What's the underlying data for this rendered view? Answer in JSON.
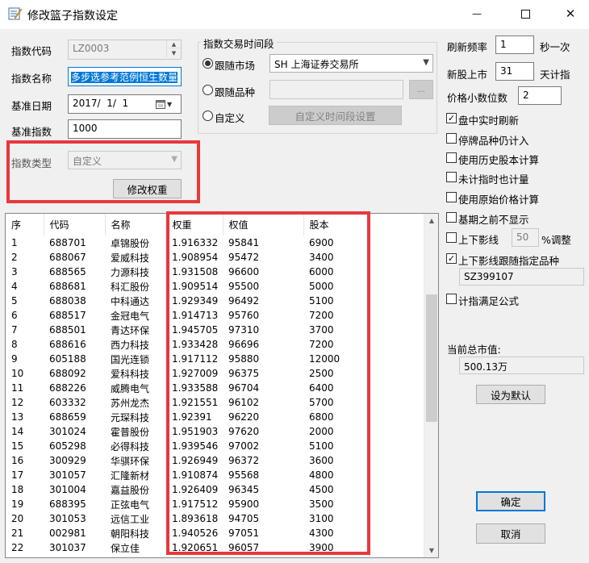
{
  "window": {
    "title": "修改篮子指数设定",
    "minimize_glyph": "—",
    "close_glyph": "✕"
  },
  "form": {
    "code_label": "指数代码",
    "code_value": "LZ0003",
    "name_label": "指数名称",
    "name_value": "多步选参考范例恒生数量",
    "base_date_label": "基准日期",
    "base_date_value": "2017/  1/  1",
    "base_index_label": "基准指数",
    "base_index_value": "1000",
    "type_label": "指数类型",
    "type_value": "自定义",
    "modify_weight_button": "修改权重"
  },
  "trade_time": {
    "group_title": "指数交易时间段",
    "follow_market_label": "跟随市场",
    "market_value": "SH 上海证券交易所",
    "follow_variety_label": "跟随品种",
    "variety_value": "",
    "browse_button": "...",
    "custom_label": "自定义",
    "custom_period_button": "自定义时间段设置",
    "selected": "follow_market"
  },
  "settings": {
    "refresh_label": "刷新频率",
    "refresh_value": "1",
    "refresh_unit": "秒一次",
    "new_stock_label": "新股上市",
    "new_stock_value": "31",
    "new_stock_unit": "天计指",
    "decimal_label": "价格小数位数",
    "decimal_value": "2",
    "checkboxes": [
      {
        "label": "盘中实时刷新",
        "checked": true
      },
      {
        "label": "停牌品种仍计入",
        "checked": false
      },
      {
        "label": "使用历史股本计算",
        "checked": false
      },
      {
        "label": "未计指时也计量",
        "checked": false
      },
      {
        "label": "使用原始价格计算",
        "checked": false
      },
      {
        "label": "基期之前不显示",
        "checked": false
      }
    ],
    "shadow_label": "上下影线",
    "shadow_value": "50",
    "shadow_unit": "%调整",
    "shadow_checked": false,
    "follow_shadow_label": "上下影线跟随指定品种",
    "follow_shadow_checked": true,
    "follow_shadow_value": "SZ399107",
    "formula_label": "计指满足公式",
    "formula_checked": false,
    "market_value_label": "当前总市值:",
    "market_value_value": "500.13万",
    "set_default_button": "设为默认",
    "ok_button": "确定",
    "cancel_button": "取消"
  },
  "table": {
    "headers": [
      "序",
      "代码",
      "名称",
      "权重",
      "权值",
      "股本"
    ],
    "rows": [
      [
        "1",
        "688701",
        "卓锦股份",
        "1.916332",
        "95841",
        "6900"
      ],
      [
        "2",
        "688067",
        "爱威科技",
        "1.908954",
        "95472",
        "3400"
      ],
      [
        "3",
        "688565",
        "力源科技",
        "1.931508",
        "96600",
        "6000"
      ],
      [
        "4",
        "688681",
        "科汇股份",
        "1.909514",
        "95500",
        "5000"
      ],
      [
        "5",
        "688038",
        "中科通达",
        "1.929349",
        "96492",
        "5100"
      ],
      [
        "6",
        "688517",
        "金冠电气",
        "1.914713",
        "95760",
        "7200"
      ],
      [
        "7",
        "688501",
        "青达环保",
        "1.945705",
        "97310",
        "3700"
      ],
      [
        "8",
        "688616",
        "西力科技",
        "1.933428",
        "96696",
        "7200"
      ],
      [
        "9",
        "605188",
        "国光连锁",
        "1.917112",
        "95880",
        "12000"
      ],
      [
        "10",
        "688092",
        "爱科科技",
        "1.927009",
        "96375",
        "2500"
      ],
      [
        "11",
        "688226",
        "威腾电气",
        "1.933588",
        "96704",
        "6400"
      ],
      [
        "12",
        "603332",
        "苏州龙杰",
        "1.921551",
        "96102",
        "5700"
      ],
      [
        "13",
        "688659",
        "元琛科技",
        "1.92391",
        "96220",
        "6800"
      ],
      [
        "14",
        "301024",
        "霍普股份",
        "1.951903",
        "97620",
        "2000"
      ],
      [
        "15",
        "605298",
        "必得科技",
        "1.939546",
        "97002",
        "5100"
      ],
      [
        "16",
        "300929",
        "华骐环保",
        "1.926949",
        "96372",
        "3600"
      ],
      [
        "17",
        "301057",
        "汇隆新材",
        "1.910874",
        "95568",
        "4800"
      ],
      [
        "18",
        "301004",
        "嘉益股份",
        "1.926409",
        "96345",
        "4500"
      ],
      [
        "19",
        "688395",
        "正弦电气",
        "1.917512",
        "95900",
        "3500"
      ],
      [
        "20",
        "301053",
        "远信工业",
        "1.893618",
        "94705",
        "3100"
      ],
      [
        "21",
        "002981",
        "朝阳科技",
        "1.940526",
        "97051",
        "4300"
      ],
      [
        "22",
        "301037",
        "保立佳",
        "1.920651",
        "96057",
        "3900"
      ]
    ]
  },
  "colors": {
    "highlight_red": "#e8383d",
    "focus_blue": "#0078d7"
  }
}
